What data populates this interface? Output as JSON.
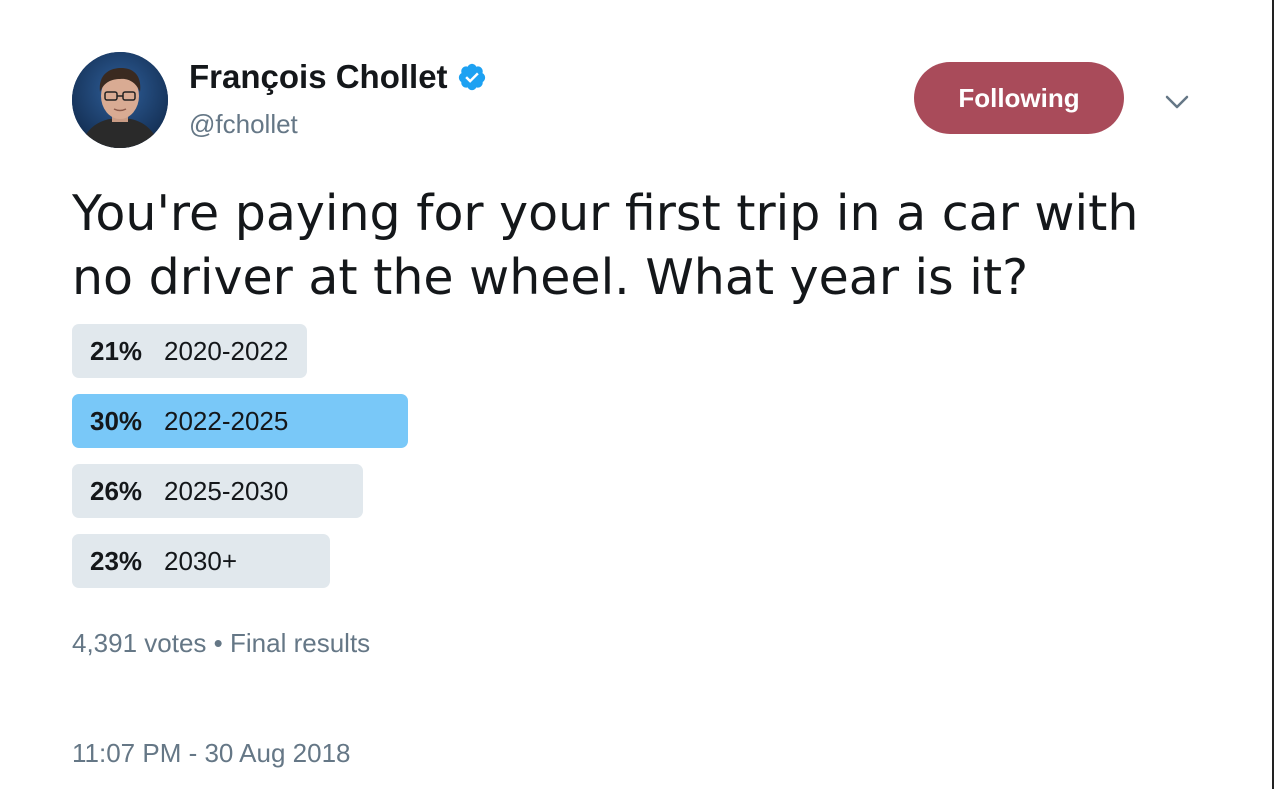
{
  "author": {
    "name": "François Chollet",
    "handle": "@fchollet",
    "verified": true
  },
  "follow_button": {
    "label": "Following",
    "color": "#a94b5a"
  },
  "menu": {
    "icon": "chevron-down-icon"
  },
  "tweet": {
    "text_line1": "You're paying for your first trip in a car with",
    "text_line2": "no driver at the wheel. What year is it?"
  },
  "poll": {
    "options": [
      {
        "percent_label": "21%",
        "percent": 21,
        "label": "2020-2022",
        "winner": false
      },
      {
        "percent_label": "30%",
        "percent": 30,
        "label": "2022-2025",
        "winner": true
      },
      {
        "percent_label": "26%",
        "percent": 26,
        "label": "2025-2030",
        "winner": false
      },
      {
        "percent_label": "23%",
        "percent": 23,
        "label": "2030+",
        "winner": false
      }
    ],
    "votes": "4,391 votes",
    "separator": "•",
    "status": "Final results",
    "bar_color": "#e1e8ed",
    "winner_color": "#79c8f8"
  },
  "timestamp": "11:07 PM - 30 Aug 2018"
}
